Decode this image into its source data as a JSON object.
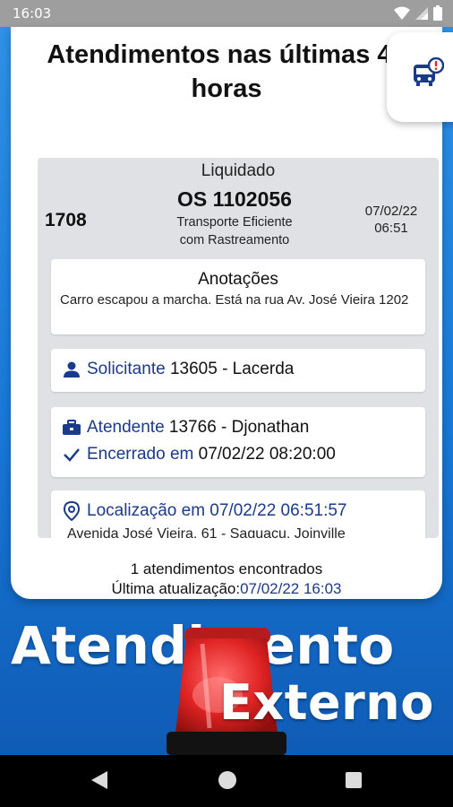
{
  "status_bar": {
    "time": "16:03"
  },
  "card": {
    "title": "Atendimentos nas últimas 48 horas",
    "fab_icon": "bus-alert-icon"
  },
  "service": {
    "status": "Liquidado",
    "number": "1708",
    "os": "OS 1102056",
    "service_line1": "Transporte Eficiente",
    "service_line2": "com Rastreamento",
    "date": "07/02/22",
    "time": "06:51",
    "notes": {
      "title": "Anotações",
      "text": "Carro escapou a marcha. Está na rua Av. José Vieira 1202"
    },
    "requester": {
      "label": "Solicitante",
      "value": "13605 - Lacerda",
      "icon": "person-icon"
    },
    "attendant": {
      "label": "Atendente",
      "value": "13766 - Djonathan",
      "icon": "toolbox-icon"
    },
    "closed": {
      "label": "Encerrado em",
      "value": "07/02/22 08:20:00",
      "icon": "check-icon"
    },
    "location": {
      "label": "Localização em 07/02/22 06:51:57",
      "address": "Avenida José Vieira, 61 - Saguaçu, Joinville",
      "icon": "location-pin-icon"
    }
  },
  "summary": {
    "found": "1 atendimentos encontrados",
    "last_update_label": "Última atualização:",
    "last_update_value": "07/02/22 16:03"
  },
  "promo": {
    "line1": "Atendimento",
    "line2": "Externo"
  },
  "colors": {
    "accent": "#1a3a8a",
    "background": "#1877d6",
    "panel": "#dfe1e4",
    "siren": "#d32f2f"
  }
}
